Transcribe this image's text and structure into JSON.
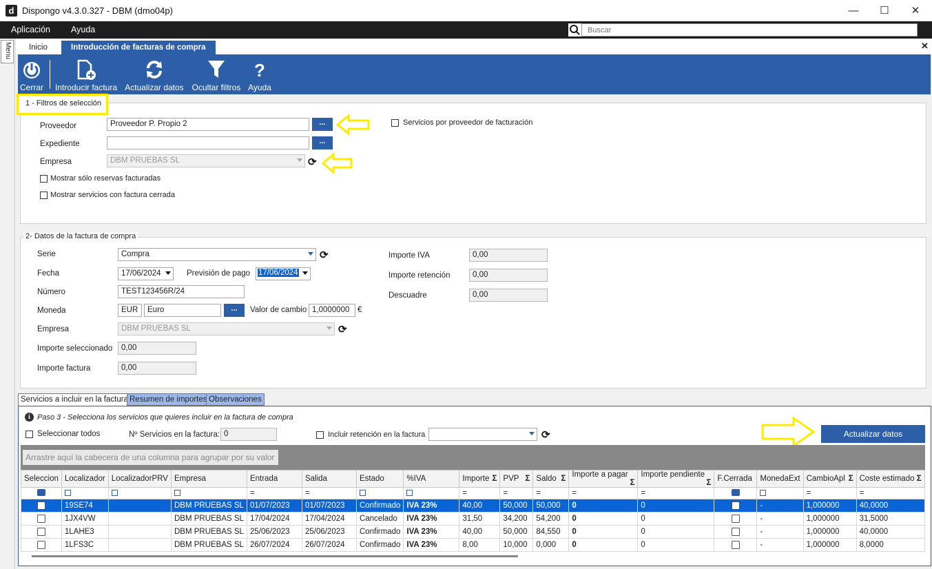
{
  "window": {
    "title": "Dispongo v4.3.0.327 - DBM (dmo04p)",
    "logo": "d",
    "minimize": "—",
    "maximize": "☐",
    "close": "✕"
  },
  "menu": {
    "items": [
      "Aplicación",
      "Ayuda"
    ],
    "search_placeholder": "Buscar",
    "side_tab": "Menu"
  },
  "tabs": {
    "home": "Inicio",
    "active": "Introducción de facturas de compra",
    "close": "✕"
  },
  "toolbar": {
    "close": "Cerrar",
    "new_invoice": "Introducir factura",
    "refresh": "Actualizar datos",
    "hide_filters": "Ocultar filtros",
    "help": "Ayuda"
  },
  "filters": {
    "legend": "1 - Filtros de selección",
    "provider_label": "Proveedor",
    "provider_value": "Proveedor P. Propio 2",
    "file_label": "Expediente",
    "file_value": "",
    "company_label": "Empresa",
    "company_value": "DBM PRUEBAS SL",
    "only_invoiced": "Mostrar sólo reservas facturadas",
    "closed_invoice": "Mostrar servicios con factura cerrada",
    "services_by_provider": "Servicios por proveedor de facturación",
    "dots": "..."
  },
  "invoice": {
    "legend": "2- Datos de la factura de compra",
    "series_label": "Serie",
    "series_value": "Compra",
    "date_label": "Fecha",
    "date_value": "17/06/2024",
    "payment_label": "Previsión de pago",
    "payment_value": "17/06/2024",
    "number_label": "Número",
    "number_value": "TEST123456R/24",
    "currency_label": "Moneda",
    "currency_code": "EUR",
    "currency_name": "Euro",
    "exchange_label": "Valor de cambio",
    "exchange_value": "1,0000000",
    "exchange_symbol": "€",
    "company_label": "Empresa",
    "company_value": "DBM PRUEBAS SL",
    "selected_label": "Importe seleccionado",
    "selected_value": "0,00",
    "invoice_amount_label": "Importe factura",
    "invoice_amount_value": "0,00",
    "vat_label": "Importe IVA",
    "vat_value": "0,00",
    "retention_label": "Importe retención",
    "retention_value": "0,00",
    "mismatch_label": "Descuadre",
    "mismatch_value": "0,00"
  },
  "bottom_tabs": [
    "Servicios a incluir en la factura",
    "Resumen de importes",
    "Observaciones"
  ],
  "services": {
    "info": "Paso 3 - Selecciona los servicios que quieres incluir en la factura de compra",
    "select_all": "Seleccionar todos",
    "count_label": "Nº Servicios en la factura:",
    "count_value": "0",
    "include_retention": "Incluir retención en la factura",
    "refresh_button": "Actualizar datos",
    "group_hint": "Arrastre aquí la cabecera de una columna para agrupar por su valor"
  },
  "grid": {
    "columns": [
      "Seleccion",
      "Localizador",
      "LocalizadorPRV",
      "Empresa",
      "Entrada",
      "Salida",
      "Estado",
      "%IVA",
      "Importe",
      "PVP",
      "Saldo",
      "Importe a pagar",
      "Importe pendiente",
      "F.Cerrada",
      "MonedaExt",
      "CambioApl",
      "Coste estimado"
    ],
    "sigma": "Σ",
    "filter_eq": "=",
    "rows": [
      [
        "",
        "19SE74",
        "",
        "DBM PRUEBAS SL",
        "01/07/2023",
        "01/07/2023",
        "Confirmado",
        "IVA 23%",
        "40,00",
        "50,000",
        "50,000",
        "0",
        "0",
        "",
        "-",
        "1,000000",
        "40,0000"
      ],
      [
        "",
        "1JX4VW",
        "",
        "DBM PRUEBAS SL",
        "17/04/2024",
        "17/04/2024",
        "Cancelado",
        "IVA 23%",
        "31,50",
        "34,200",
        "54,200",
        "0",
        "0",
        "",
        "-",
        "1,000000",
        "31,5000"
      ],
      [
        "",
        "1LAHE3",
        "",
        "DBM PRUEBAS SL",
        "25/06/2023",
        "25/06/2023",
        "Confirmado",
        "IVA 23%",
        "40,00",
        "50,000",
        "84,550",
        "0",
        "0",
        "",
        "-",
        "1,000000",
        "40,0000"
      ],
      [
        "",
        "1LFS3C",
        "",
        "DBM PRUEBAS SL",
        "26/07/2024",
        "26/07/2024",
        "Confirmado",
        "IVA 23%",
        "8,00",
        "10,000",
        "0,000",
        "0",
        "0",
        "",
        "-",
        "1,000000",
        "8,0000"
      ]
    ]
  },
  "colors": {
    "toolbar_blue": "#2d5fa8",
    "selection_blue": "#0a64d6",
    "highlight_yellow": "#ffeb00"
  }
}
